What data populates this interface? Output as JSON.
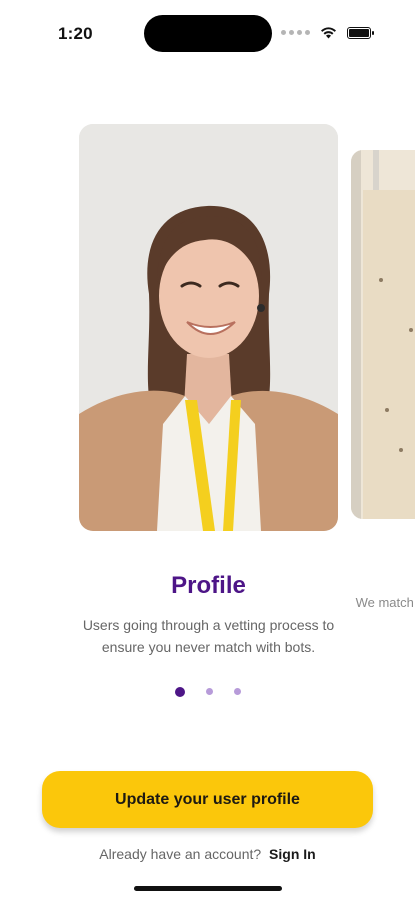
{
  "status_bar": {
    "time": "1:20",
    "icons": [
      "signal-dots-icon",
      "wifi-icon",
      "battery-icon"
    ]
  },
  "onboarding": {
    "slides": [
      {
        "title": "Profile",
        "description": "Users going through a vetting process to ensure you never match with bots.",
        "image": "woman-smiling-with-yellow-lanyard-photo"
      },
      {
        "title": "",
        "description": "We match large an",
        "image": "wooden-panel-photo"
      }
    ],
    "active_index": 0,
    "page_count": 3
  },
  "cta": {
    "label": "Update your user profile"
  },
  "signin": {
    "prompt": "Already have an account?",
    "link_label": "Sign In"
  },
  "colors": {
    "accent_purple": "#4d1587",
    "button_yellow": "#fbc70b",
    "dot_inactive": "#b79bd9"
  }
}
